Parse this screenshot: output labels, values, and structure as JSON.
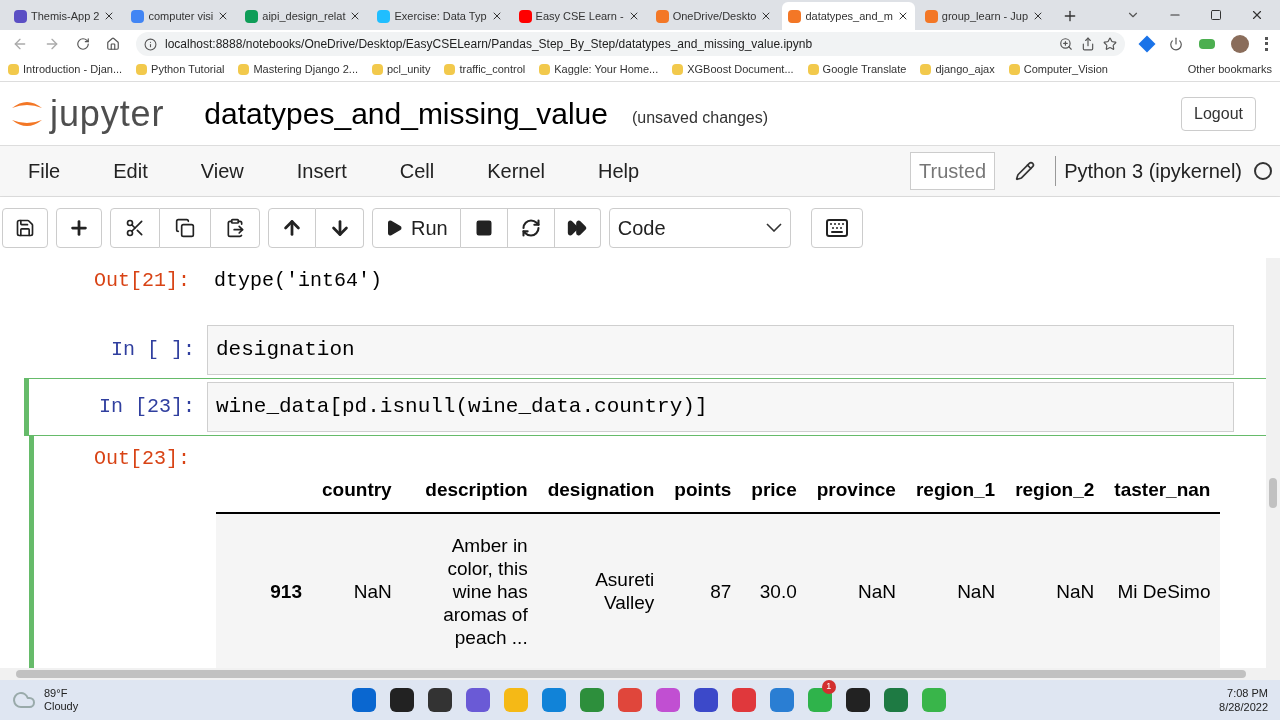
{
  "browser": {
    "tabs": [
      {
        "label": "Themis-App 2",
        "selected": false,
        "color": "#5b4fc4"
      },
      {
        "label": "computer visi",
        "selected": false,
        "color": "#4285f4"
      },
      {
        "label": "aipi_design_relat",
        "selected": false,
        "color": "#0f9d58"
      },
      {
        "label": "Exercise: Data Typ",
        "selected": false,
        "color": "#20beff"
      },
      {
        "label": "Easy CSE Learn -",
        "selected": false,
        "color": "#ff0000"
      },
      {
        "label": "OneDrive/Deskto",
        "selected": false,
        "color": "#f37726"
      },
      {
        "label": "datatypes_and_m",
        "selected": true,
        "color": "#f37726"
      },
      {
        "label": "group_learn - Jup",
        "selected": false,
        "color": "#f37726"
      }
    ],
    "url": "localhost:8888/notebooks/OneDrive/Desktop/EasyCSELearn/Pandas_Step_By_Step/datatypes_and_missing_value.ipynb",
    "bookmarks": [
      "Introduction - Djan...",
      "Python Tutorial",
      "Mastering Django 2...",
      "pcl_unity",
      "traffic_control",
      "Kaggle: Your Home...",
      "XGBoost Document...",
      "Google Translate",
      "django_ajax",
      "Computer_Vision"
    ],
    "other_bookmarks": "Other bookmarks"
  },
  "jupyter": {
    "logo": "jupyter",
    "title": "datatypes_and_missing_value",
    "status": "(unsaved changes)",
    "logout": "Logout",
    "menu": [
      "File",
      "Edit",
      "View",
      "Insert",
      "Cell",
      "Kernel",
      "Help"
    ],
    "trusted": "Trusted",
    "kernel": "Python 3 (ipykernel)",
    "run": "Run",
    "cell_type": "Code"
  },
  "cells": [
    {
      "kind": "output",
      "prompt": "Out[21]:",
      "text": "dtype('int64')"
    },
    {
      "kind": "input",
      "prompt": "In [ ]:",
      "code": "designation",
      "selected": false
    },
    {
      "kind": "input",
      "prompt": "In [23]:",
      "code": "wine_data[pd.isnull(wine_data.country)]",
      "selected": true
    },
    {
      "kind": "table",
      "prompt": "Out[23]:",
      "table": {
        "columns": [
          "",
          "country",
          "description",
          "designation",
          "points",
          "price",
          "province",
          "region_1",
          "region_2",
          "taster_nan"
        ],
        "rows": [
          [
            "913",
            "NaN",
            "Amber in color, this wine has aromas of peach ...",
            "Asureti Valley",
            "87",
            "30.0",
            "NaN",
            "NaN",
            "NaN",
            "Mi DeSimo"
          ]
        ]
      }
    }
  ],
  "taskbar": {
    "weather_temp": "89°F",
    "weather_text": "Cloudy",
    "badge": "1",
    "time": "7:08 PM",
    "date": "8/28/2022"
  }
}
